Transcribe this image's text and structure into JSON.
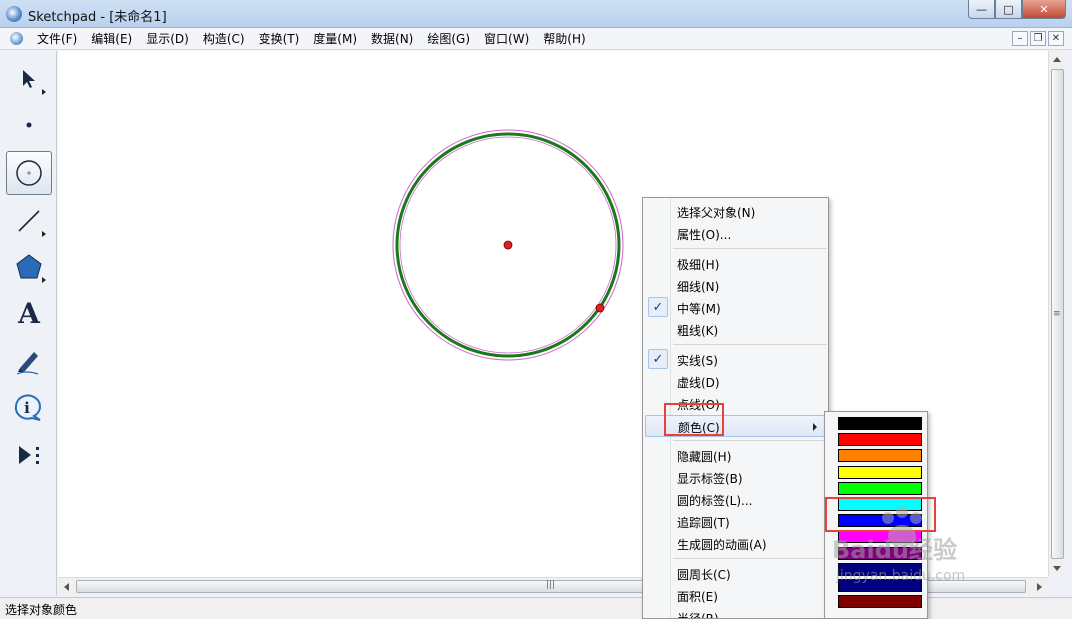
{
  "window": {
    "title": "Sketchpad  - [未命名1]"
  },
  "menu": {
    "items": [
      "文件(F)",
      "编辑(E)",
      "显示(D)",
      "构造(C)",
      "变换(T)",
      "度量(M)",
      "数据(N)",
      "绘图(G)",
      "窗口(W)",
      "帮助(H)"
    ]
  },
  "toolbox": {
    "tools": [
      {
        "icon": "arrow-select-icon"
      },
      {
        "icon": "point-icon"
      },
      {
        "icon": "compass-circle-icon",
        "selected": true
      },
      {
        "icon": "straightedge-line-icon"
      },
      {
        "icon": "polygon-icon"
      },
      {
        "icon": "text-tool-icon",
        "glyph": "A"
      },
      {
        "icon": "marker-pen-icon"
      },
      {
        "icon": "information-icon",
        "glyph": "i"
      },
      {
        "icon": "custom-tool-icon"
      }
    ]
  },
  "context_menu": {
    "items": [
      {
        "label": "选择父对象(N)"
      },
      {
        "label": "属性(O)..."
      },
      {
        "label": "极细(H)"
      },
      {
        "label": "细线(N)"
      },
      {
        "label": "中等(M)",
        "checked": true
      },
      {
        "label": "粗线(K)"
      },
      {
        "label": "实线(S)",
        "checked": true
      },
      {
        "label": "虚线(D)"
      },
      {
        "label": "点线(O)"
      },
      {
        "label": "颜色(C)",
        "highlighted": true,
        "submenu": true
      },
      {
        "label": "隐藏圆(H)"
      },
      {
        "label": "显示标签(B)"
      },
      {
        "label": "圆的标签(L)..."
      },
      {
        "label": "追踪圆(T)"
      },
      {
        "label": "生成圆的动画(A)"
      },
      {
        "label": "圆周长(C)"
      },
      {
        "label": "面积(E)"
      },
      {
        "label": "半径(R)"
      }
    ]
  },
  "color_submenu": {
    "swatches": [
      "#000000",
      "#ff0000",
      "#ff8000",
      "#ffff00",
      "#00ff00",
      "#00ffff",
      "#0000ff",
      "#ff00ff",
      "#800080",
      "#000080",
      "#000080",
      "#800000"
    ]
  },
  "circle": {
    "stroke_color": "#1a7a1a",
    "highlight_color": "#cc66cc",
    "point_color": "#e02020"
  },
  "status": {
    "text": "选择对象颜色"
  },
  "watermark": {
    "text": "Baidu经验",
    "url": "jingyan.baidu.com"
  }
}
